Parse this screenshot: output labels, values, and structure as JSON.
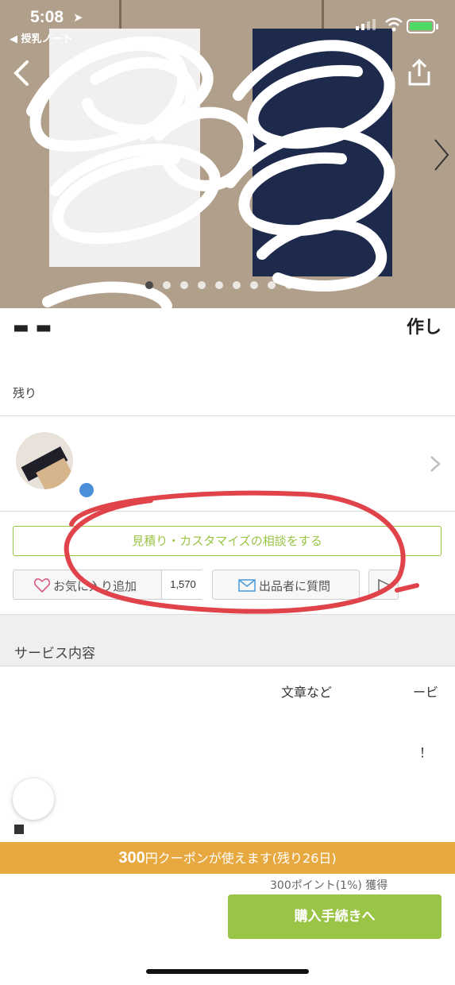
{
  "status_bar": {
    "time": "5:08",
    "back_app": "◀ 授乳ノート"
  },
  "hero": {
    "slide_count": 10,
    "active_slide": 1
  },
  "listing": {
    "title_partial": "作し",
    "remaining_label": "残り"
  },
  "actions": {
    "consult_label": "見積り・カスタマイズの相談をする",
    "favorite_label": "お気に入り追加",
    "favorite_count": "1,570",
    "question_label": "出品者に質問"
  },
  "service": {
    "header": "サービス内容",
    "fragment_1": "文章など",
    "fragment_2": "ービ",
    "fragment_3": "！"
  },
  "coupon": {
    "amount": "300",
    "unit": "円",
    "text": "クーポンが使えます(残り26日)"
  },
  "purchase": {
    "points": "300ポイント(1%) 獲得",
    "buy_label": "購入手続きへ"
  },
  "colors": {
    "accent_green": "#9ac445",
    "coupon_orange": "#e8a840",
    "annotation_red": "#e0444a"
  }
}
